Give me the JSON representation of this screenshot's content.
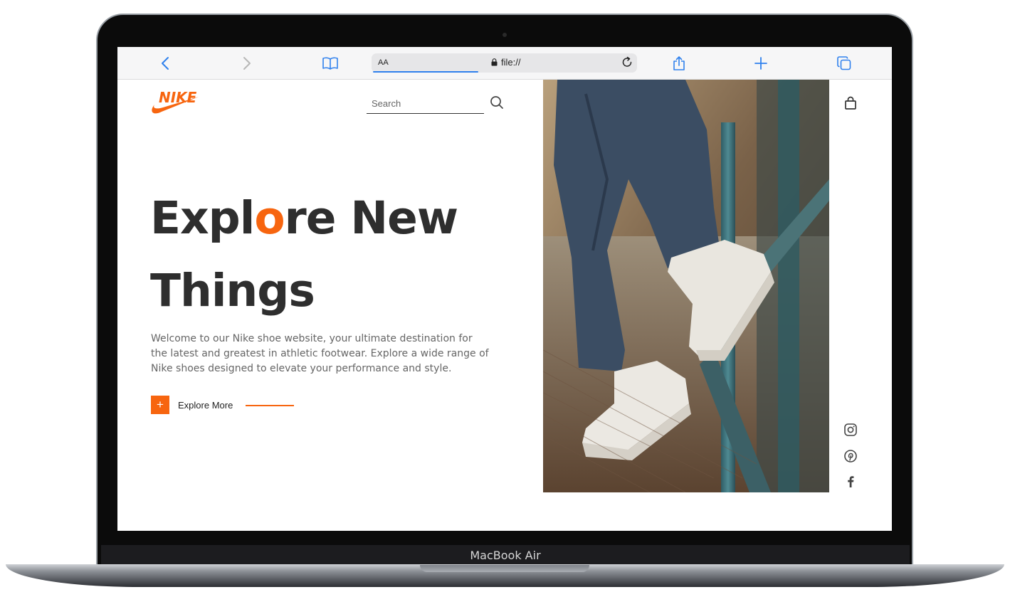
{
  "device": {
    "label": "MacBook Air"
  },
  "browser": {
    "address_prefix": "AA",
    "url": "file://"
  },
  "page": {
    "brand": "NIKE",
    "search": {
      "placeholder": "Search",
      "value": ""
    },
    "headline": {
      "part1": "Expl",
      "accent_letter": "o",
      "part2": "re New",
      "line2": "Things"
    },
    "description": "Welcome to our Nike shoe website, your ultimate destination for the latest and greatest in athletic footwear. Explore a wide range of Nike shoes designed to elevate your performance and style.",
    "cta": {
      "icon_text": "+",
      "label": "Explore More"
    },
    "social": [
      "instagram",
      "pinterest",
      "facebook"
    ],
    "colors": {
      "accent": "#f7650f",
      "text_dark": "#2e2e2e",
      "text_muted": "#666666",
      "safari_blue": "#2f80ed"
    }
  }
}
